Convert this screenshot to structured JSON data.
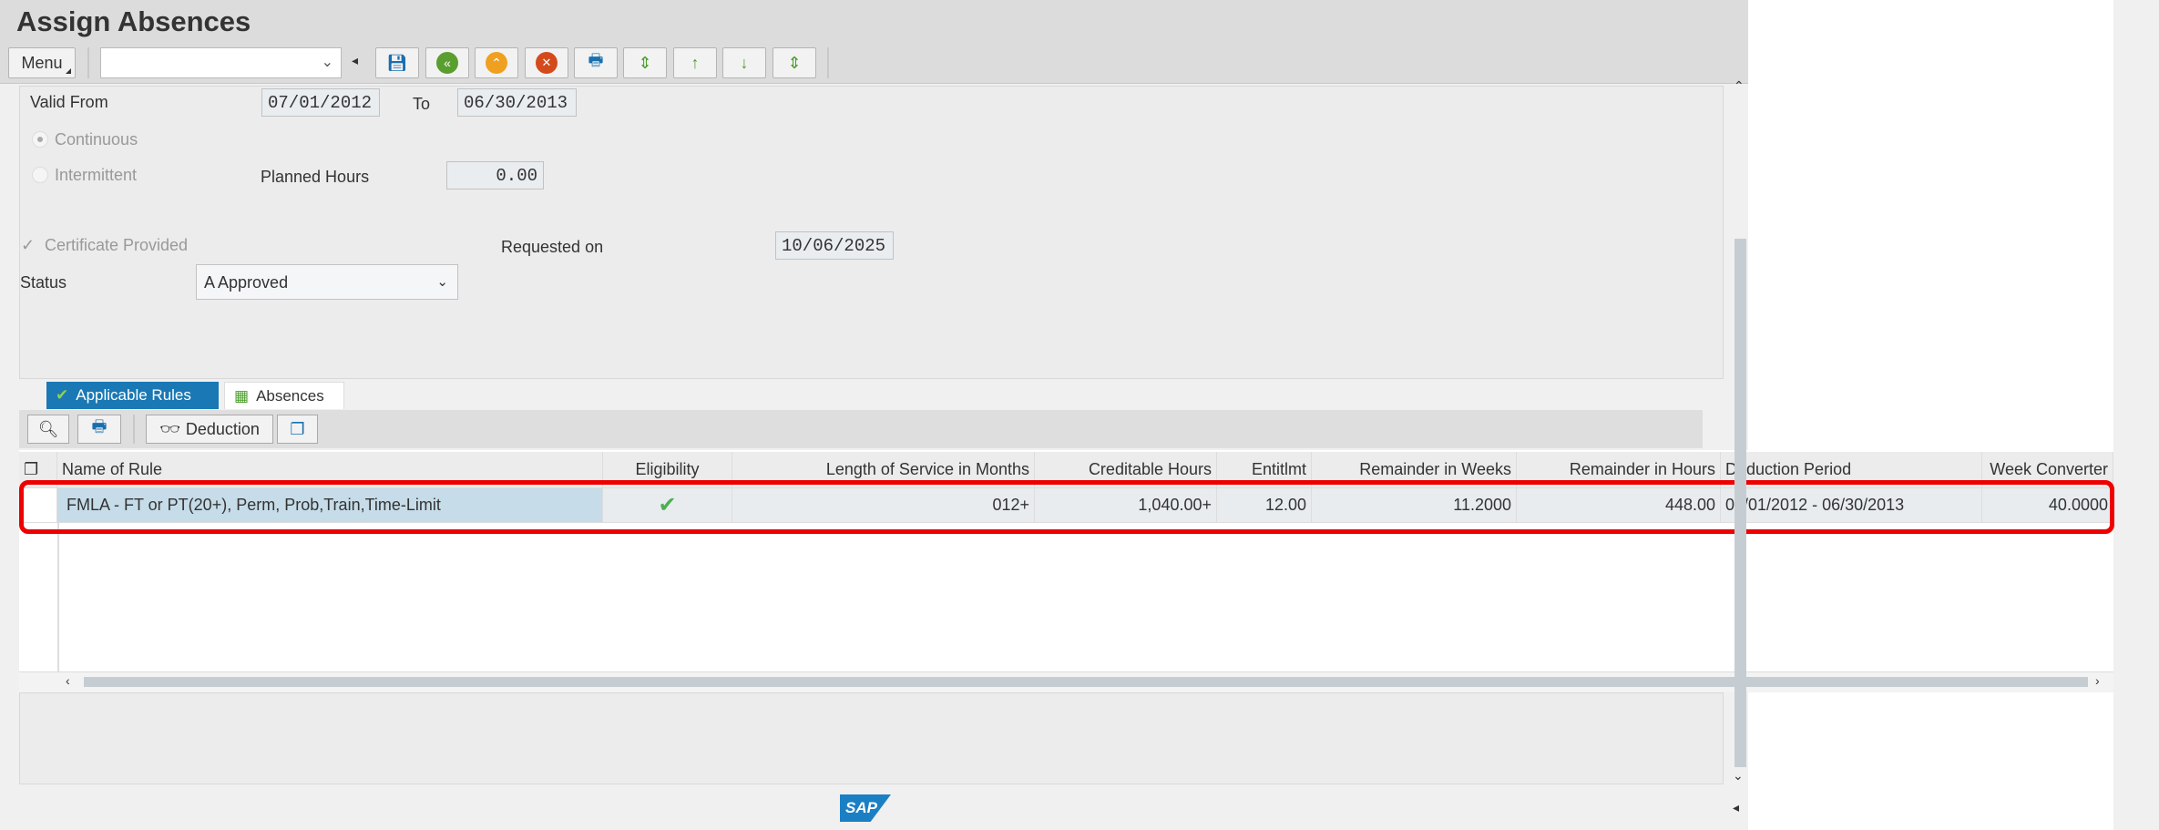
{
  "window": {
    "title": "Assign Absences"
  },
  "toolbar": {
    "menu_label": "Menu",
    "command_value": "",
    "icons": [
      "save-icon",
      "back-icon",
      "exit-icon",
      "cancel-icon",
      "print-icon",
      "first-page-icon",
      "previous-page-icon",
      "next-page-icon",
      "last-page-icon"
    ]
  },
  "form": {
    "valid_from_label": "Valid From",
    "valid_from": "07/01/2012",
    "to_label": "To",
    "valid_to": "06/30/2013",
    "continuous_label": "Continuous",
    "intermittent_label": "Intermittent",
    "planned_hours_label": "Planned Hours",
    "planned_hours": "0.00",
    "certificate_label": "Certificate Provided",
    "requested_on_label": "Requested on",
    "requested_on": "10/06/2025",
    "status_label": "Status",
    "status_value": "A Approved"
  },
  "tabs": [
    {
      "label": "Applicable Rules",
      "active": true
    },
    {
      "label": "Absences",
      "active": false
    }
  ],
  "table_toolbar": {
    "deduction_label": "Deduction"
  },
  "table": {
    "columns": [
      "Name of Rule",
      "Eligibility",
      "Length of Service in Months",
      "Creditable Hours",
      "Entitlmt",
      "Remainder in Weeks",
      "Remainder in Hours",
      "Deduction Period",
      "Week Converter"
    ],
    "rows": [
      {
        "name": "FMLA - FT or PT(20+), Perm, Prob,Train,Time-Limit",
        "eligibility": "✔",
        "los": "012+",
        "creditable": "1,040.00+",
        "entitlement": "12.00",
        "rem_weeks": "11.2000",
        "rem_hours": "448.00",
        "period": "07/01/2012 - 06/30/2013",
        "week_conv": "40.0000"
      }
    ]
  },
  "footer": {
    "logo": "SAP"
  },
  "colors": {
    "accent": "#1a78b4",
    "highlight": "#e00000",
    "check": "#4caf50"
  }
}
